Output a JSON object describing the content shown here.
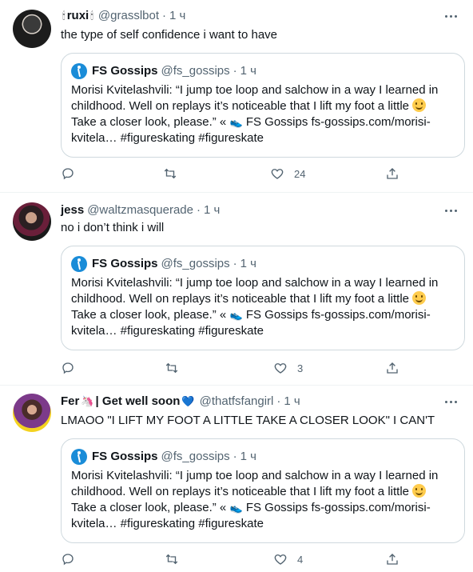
{
  "tweets": [
    {
      "name": "ruxi",
      "name_emoji_left": "🕯",
      "name_emoji_right": "🕯",
      "handle": "@grasslbot",
      "time": "1 ч",
      "text": "the type of self confidence i want to have",
      "quote": {
        "name": "FS Gossips",
        "handle": "@fs_gossips",
        "time": "1 ч",
        "line1": "Morisi Kvitelashvili: “I jump toe loop and salchow in a way I learned in",
        "line2": "childhood. Well on replays it’s noticeable that I lift my foot a little",
        "line3a": "Take a closer look, please.” «",
        "line3b": "FS Gossips fs-gossips.com/morisi-",
        "line4": "kvitela… #figureskating #figureskate"
      },
      "likes": "24"
    },
    {
      "name": "jess",
      "handle": "@waltzmasquerade",
      "time": "1 ч",
      "text": "no i don’t think i will",
      "quote": {
        "name": "FS Gossips",
        "handle": "@fs_gossips",
        "time": "1 ч",
        "line1": "Morisi Kvitelashvili: “I jump toe loop and salchow in a way I learned in",
        "line2": "childhood. Well on replays it’s noticeable that I lift my foot a little",
        "line3a": "Take a closer look, please.” «",
        "line3b": "FS Gossips fs-gossips.com/morisi-",
        "line4": "kvitela… #figureskating #figureskate"
      },
      "likes": "3"
    },
    {
      "name": "Fer",
      "name_suffix": "| Get well soon",
      "name_emoji_left": "🦄",
      "name_emoji_right": "💙",
      "handle": "@thatfsfangirl",
      "time": "1 ч",
      "text": "LMAOO \"I LIFT MY FOOT A LITTLE TAKE A CLOSER LOOK\" I CAN'T",
      "quote": {
        "name": "FS Gossips",
        "handle": "@fs_gossips",
        "time": "1 ч",
        "line1": "Morisi Kvitelashvili: “I jump toe loop and salchow in a way I learned in",
        "line2": "childhood. Well on replays it’s noticeable that I lift my foot a little",
        "line3a": "Take a closer look, please.” «",
        "line3b": "FS Gossips fs-gossips.com/morisi-",
        "line4": "kvitela… #figureskating #figureskate"
      },
      "likes": "4"
    }
  ],
  "icons": {
    "reply": "reply-icon",
    "retweet": "retweet-icon",
    "like": "like-icon",
    "share": "share-icon",
    "more": "more-icon",
    "emoji_smile": "slightly-smiling-face-emoji",
    "emoji_shoe": "skate-shoe-emoji"
  },
  "colors": {
    "secondary_text": "#536471",
    "border": "#eff3f4",
    "quote_border": "#cfd9de",
    "quote_avatar": "#1a8cd8"
  }
}
